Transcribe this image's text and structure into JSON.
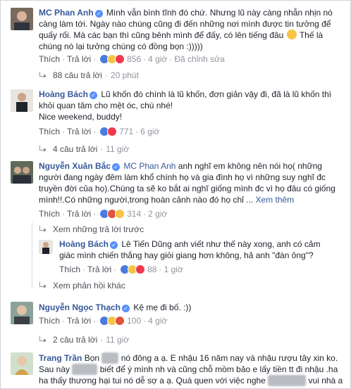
{
  "comments": [
    {
      "name": "MC Phan Anh",
      "text": "Mình vẫn bình tĩnh đó chứ. Nhưng lũ này càng nhẫn nhịn nó càng làm tới. Ngày nào chúng cũng đi đến những nơi mình được tin tưởng để quấy rối. Mà các bạn thì cũng bênh mình để đấy, có lên tiếng đâu",
      "text2": "Thế là chúng nó lại tưởng chúng có đồng bọn :)))))",
      "like": "Thích",
      "reply": "Trả lời",
      "count": "856",
      "time": "4 giờ",
      "edited": "Đã chỉnh sửa",
      "replies": "88 câu trả lời",
      "replies_time": "20 phút"
    },
    {
      "name": "Hoàng Bách",
      "text": "Lũ khốn đó chính là lũ khốn, đơn giản vậy đi, đã là lũ khốn thì khỏi quan tâm cho mệt óc, chú nhé!",
      "text2": "Nice weekend, buddy!",
      "like": "Thích",
      "reply": "Trả lời",
      "count": "771",
      "time": "6 giờ",
      "replies": "4 câu trả lời",
      "replies_time": "11 giờ"
    },
    {
      "name": "Nguyễn Xuân Bắc",
      "mention": "MC Phan Anh",
      "text": "anh nghĩ em không nên nói họ( những người đang ngày đêm làm khổ chính họ và gia đình họ vì những suy nghĩ đc truyền đời của họ).Chúng ta sẽ ko bắt ai nghĩ giống mình đc vì họ đâu có giống mình!!.Có những người,trong hoàn cảnh nào đó họ chỉ ...",
      "see_more": "Xem thêm",
      "like": "Thích",
      "reply": "Trả lời",
      "count": "314",
      "time": "2 giờ",
      "prev_replies": "Xem những trả lời trước",
      "reply_item": {
        "name": "Hoàng Bách",
        "text": "Lê Tiến Dũng anh viết như thế này xong, anh có cảm giác mình chiến thắng hay giỏi giang hơn không, hả anh \"đàn ông\"?",
        "like": "Thích",
        "reply": "Trả lời",
        "count": "88",
        "time": "1 giờ"
      },
      "more_replies": "Xem phản hồi khác"
    },
    {
      "name": "Nguyễn Ngọc Thạch",
      "text": "Kệ mẹ đi bố. :))",
      "like": "Thích",
      "reply": "Trả lời",
      "count": "100",
      "time": "4 giờ",
      "replies": "2 câu trả lời",
      "replies_time": "11 giờ"
    },
    {
      "name": "Trang Trần",
      "text_a": "Bọn",
      "text_b": "nó đông a ạ. E nhậu 16 năm nay và nhậu rượu tây xin ko. Sau này",
      "text_c": "biết để ý mình nh và cũng chỗ mồm bảo e lấy tiền tt đi nhậu .ha ha thấy thương hại tui nó dễ sợ a ạ. Quá quen với việc nghe",
      "text_d": "vui nhà a a"
    }
  ],
  "colors": {
    "link": "#365899",
    "meta": "#90949c",
    "verified": "#5890ff"
  }
}
